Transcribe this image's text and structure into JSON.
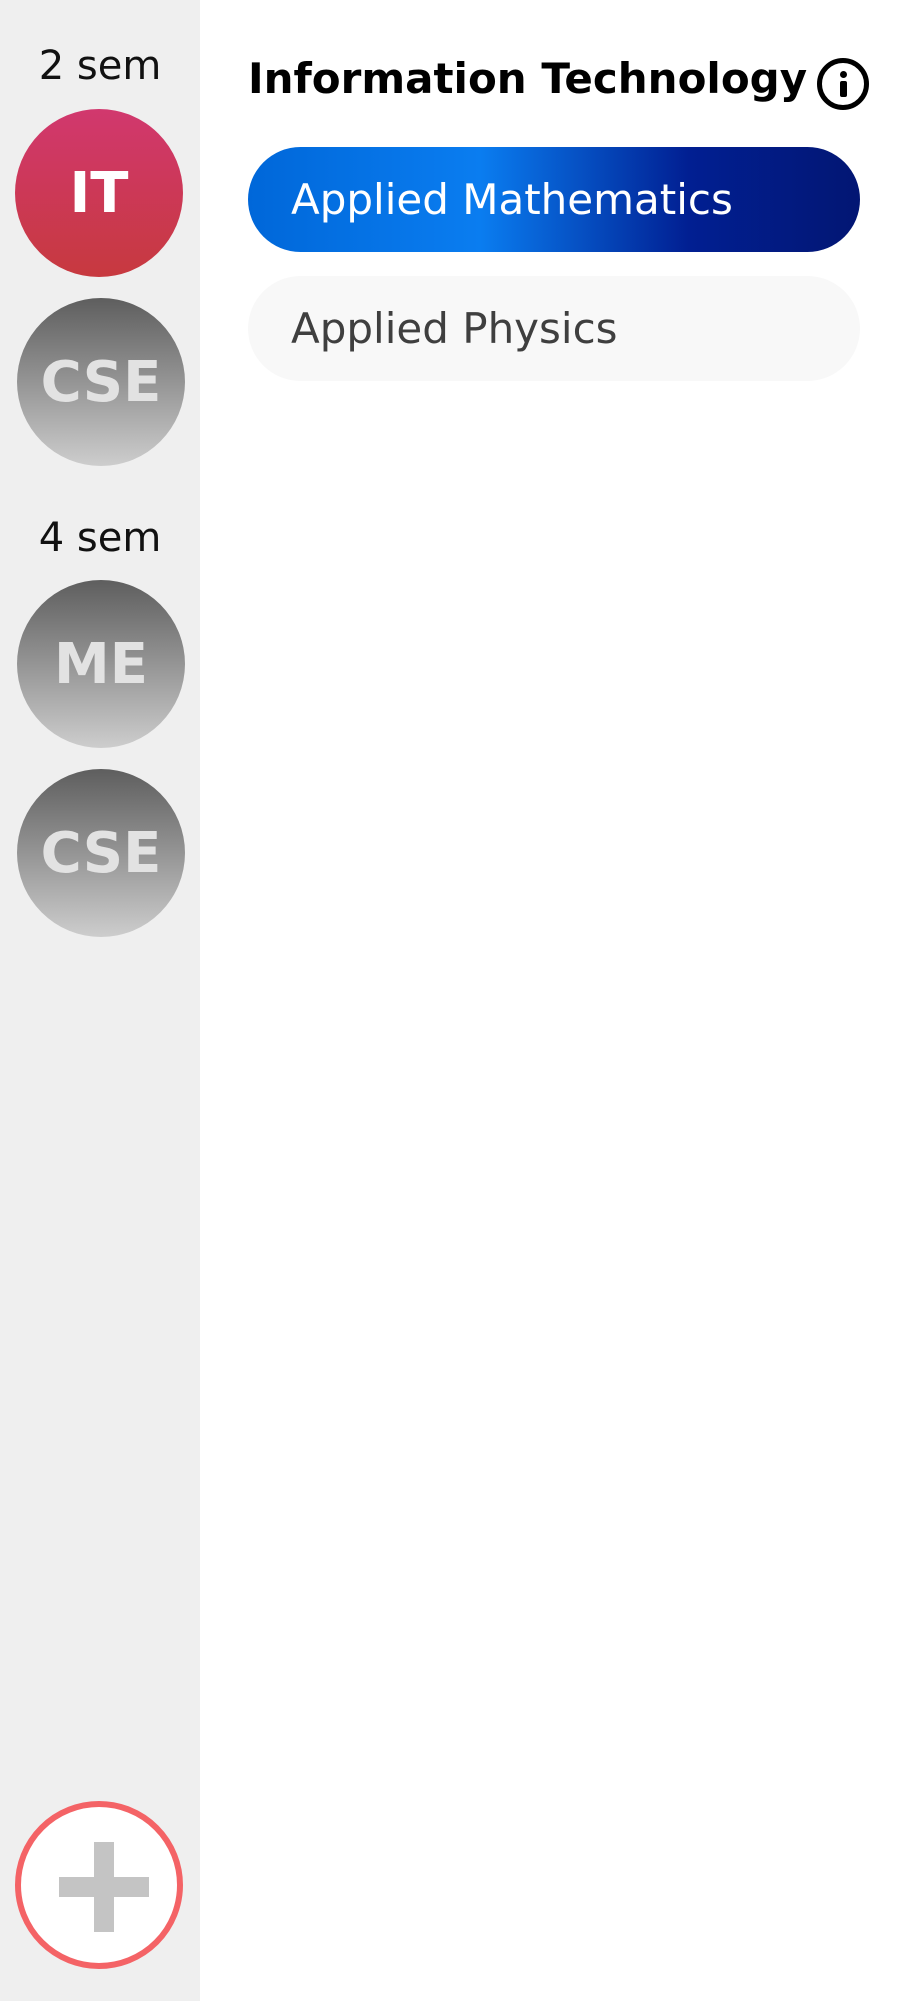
{
  "sidebar": {
    "groups": [
      {
        "label": "2 sem",
        "branches": [
          {
            "label": "IT",
            "active": true
          },
          {
            "label": "CSE",
            "active": false
          }
        ]
      },
      {
        "label": "4 sem",
        "branches": [
          {
            "label": "ME",
            "active": false
          },
          {
            "label": "CSE",
            "active": false
          }
        ]
      }
    ],
    "add_icon": "plus-icon"
  },
  "main": {
    "title": "Information Technology",
    "info_icon": "info-icon",
    "subjects": [
      {
        "label": "Applied Mathematics",
        "selected": true
      },
      {
        "label": "Applied Physics",
        "selected": false
      }
    ]
  },
  "colors": {
    "active_avatar": "#d1386e",
    "add_button_border": "#f46366",
    "selected_subject": "#0067d9",
    "sidebar_bg": "#efefef"
  }
}
